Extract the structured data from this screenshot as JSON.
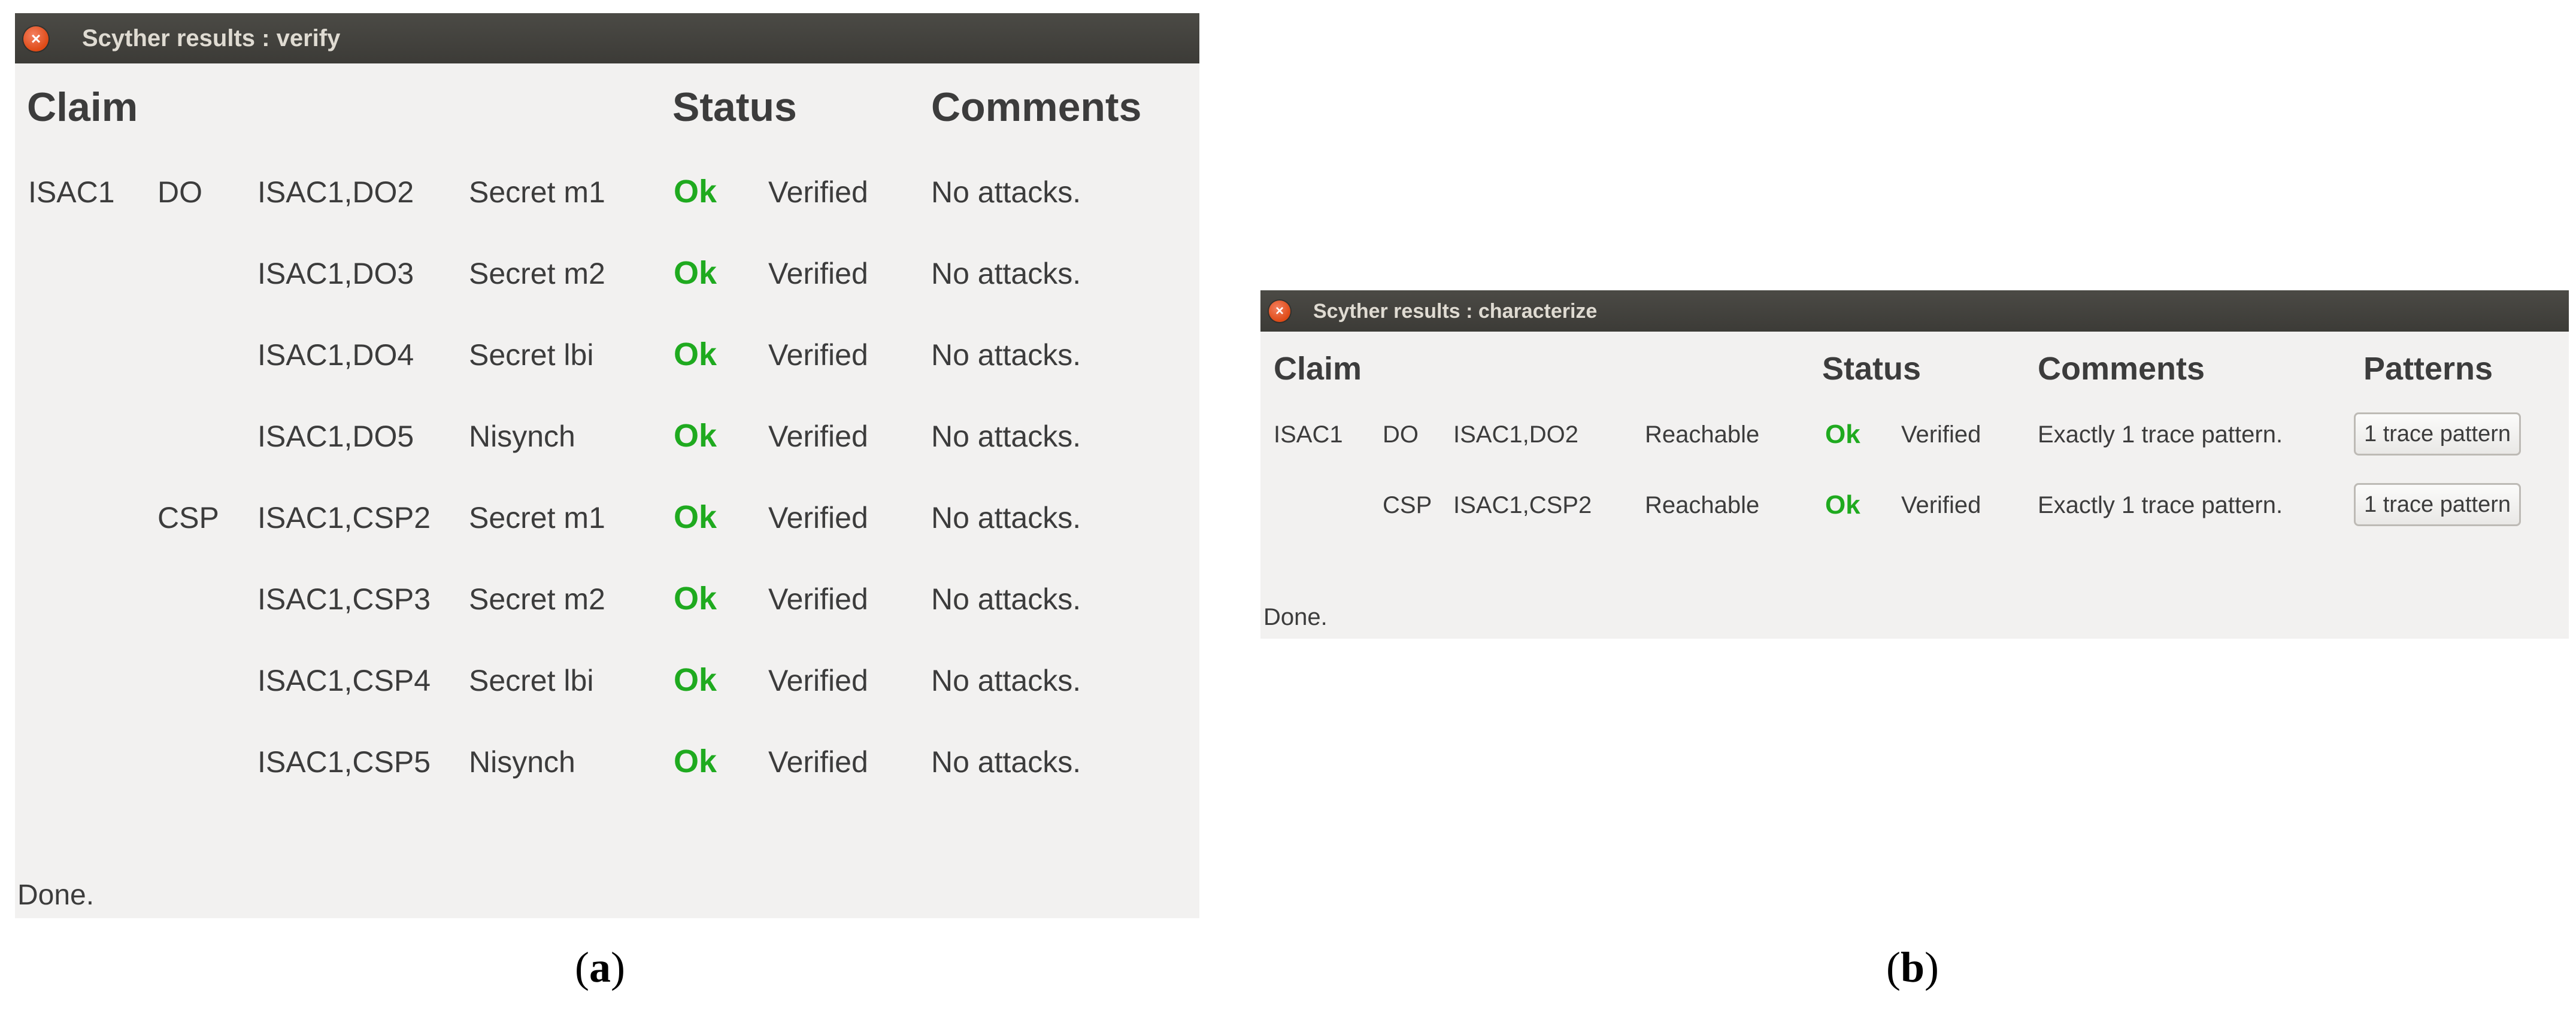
{
  "window_a": {
    "title": "Scyther results : verify",
    "headers": {
      "claim": "Claim",
      "status": "Status",
      "comments": "Comments"
    },
    "rows": [
      {
        "proto": "ISAC1",
        "role": "DO",
        "id": "ISAC1,DO2",
        "claim": "Secret m1",
        "status": "Ok",
        "result": "Verified",
        "comment": "No attacks."
      },
      {
        "proto": "",
        "role": "",
        "id": "ISAC1,DO3",
        "claim": "Secret m2",
        "status": "Ok",
        "result": "Verified",
        "comment": "No attacks."
      },
      {
        "proto": "",
        "role": "",
        "id": "ISAC1,DO4",
        "claim": "Secret lbi",
        "status": "Ok",
        "result": "Verified",
        "comment": "No attacks."
      },
      {
        "proto": "",
        "role": "",
        "id": "ISAC1,DO5",
        "claim": "Nisynch",
        "status": "Ok",
        "result": "Verified",
        "comment": "No attacks."
      },
      {
        "proto": "",
        "role": "CSP",
        "id": "ISAC1,CSP2",
        "claim": "Secret m1",
        "status": "Ok",
        "result": "Verified",
        "comment": "No attacks."
      },
      {
        "proto": "",
        "role": "",
        "id": "ISAC1,CSP3",
        "claim": "Secret m2",
        "status": "Ok",
        "result": "Verified",
        "comment": "No attacks."
      },
      {
        "proto": "",
        "role": "",
        "id": "ISAC1,CSP4",
        "claim": "Secret lbi",
        "status": "Ok",
        "result": "Verified",
        "comment": "No attacks."
      },
      {
        "proto": "",
        "role": "",
        "id": "ISAC1,CSP5",
        "claim": "Nisynch",
        "status": "Ok",
        "result": "Verified",
        "comment": "No attacks."
      }
    ],
    "status_line": "Done."
  },
  "window_b": {
    "title": "Scyther results : characterize",
    "headers": {
      "claim": "Claim",
      "status": "Status",
      "comments": "Comments",
      "patterns": "Patterns"
    },
    "rows": [
      {
        "proto": "ISAC1",
        "role": "DO",
        "id": "ISAC1,DO2",
        "claim": "Reachable",
        "status": "Ok",
        "result": "Verified",
        "comment": "Exactly 1 trace pattern.",
        "pattern_button": "1 trace pattern"
      },
      {
        "proto": "",
        "role": "CSP",
        "id": "ISAC1,CSP2",
        "claim": "Reachable",
        "status": "Ok",
        "result": "Verified",
        "comment": "Exactly 1 trace pattern.",
        "pattern_button": "1 trace pattern"
      }
    ],
    "status_line": "Done."
  },
  "captions": {
    "a": "a",
    "b": "b"
  },
  "colors": {
    "ok": "#1faa1f",
    "titlebar": "#3c3b37",
    "close": "#df4a16",
    "window_bg": "#f2f1f0"
  }
}
